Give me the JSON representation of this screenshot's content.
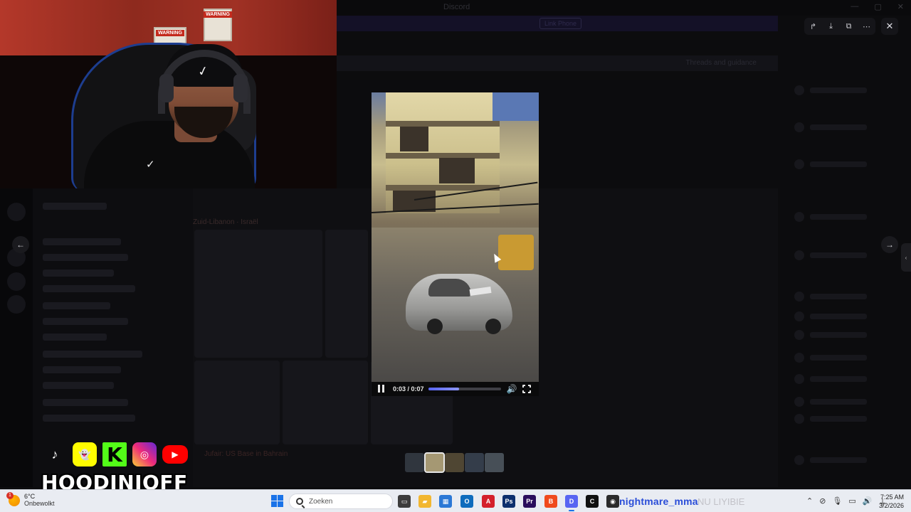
{
  "background": {
    "app_title": "Discord",
    "banner_button": "Link Phone",
    "channel_button": "Threads and guidance",
    "post_title_a": "Zuid-Libanon",
    "post_title_b": "Israël",
    "bottom_link": "Jufair: US Base in Bahrain"
  },
  "lightbox": {
    "actions": [
      {
        "name": "forward-icon",
        "glyph": "↱"
      },
      {
        "name": "download-icon",
        "glyph": "⤓"
      },
      {
        "name": "open-external-icon",
        "glyph": "⧉"
      },
      {
        "name": "more-icon",
        "glyph": "⋯"
      }
    ],
    "close_glyph": "✕",
    "prev_glyph": "←",
    "next_glyph": "→",
    "side_tab_glyph": "‹"
  },
  "video": {
    "time_text": "0:03 / 0:07",
    "progress_fraction": 0.43,
    "volume_glyph": "🔊"
  },
  "thumbnails": [
    {
      "color": "#46505c",
      "active": false
    },
    {
      "color": "#a59873",
      "active": true
    },
    {
      "color": "#7a6a4a",
      "active": false
    },
    {
      "color": "#4c5b70",
      "active": false
    },
    {
      "color": "#6d7a86",
      "active": false
    }
  ],
  "overlay": {
    "social": [
      {
        "name": "tiktok-icon",
        "glyph": "♪"
      },
      {
        "name": "snapchat-icon",
        "glyph": "👻"
      },
      {
        "name": "kick-icon",
        "glyph": "K"
      },
      {
        "name": "instagram-icon",
        "glyph": "◎"
      },
      {
        "name": "youtube-icon",
        "glyph": "▶"
      }
    ],
    "brand": "HOODINIOFF"
  },
  "webcam": {
    "sign_text": "WARNING"
  },
  "taskbar": {
    "weather_temp": "6°C",
    "weather_desc": "Onbewolkt",
    "weather_badge": "1",
    "search_placeholder": "Zoeken",
    "apps": [
      {
        "name": "task-view-icon",
        "label": "▭",
        "color": "#3c3c3c"
      },
      {
        "name": "file-explorer-icon",
        "label": "▰",
        "color": "#f2b731"
      },
      {
        "name": "store-icon",
        "label": "▦",
        "color": "#2b78d6"
      },
      {
        "name": "outlook-icon",
        "label": "O",
        "color": "#0f6cbd"
      },
      {
        "name": "acrobat-icon",
        "label": "A",
        "color": "#d4202c"
      },
      {
        "name": "photoshop-icon",
        "label": "Ps",
        "color": "#0d2f6e"
      },
      {
        "name": "premiere-icon",
        "label": "Pr",
        "color": "#2a0d5c"
      },
      {
        "name": "brave-icon",
        "label": "B",
        "color": "#f04a1d"
      },
      {
        "name": "discord-icon",
        "label": "D",
        "color": "#5865f2"
      },
      {
        "name": "capcut-icon",
        "label": "C",
        "color": "#111111"
      },
      {
        "name": "obs-icon",
        "label": "◉",
        "color": "#2b2b2b"
      }
    ],
    "stream_label": "nightmare_mma",
    "stream_label2": "NU LIYIBIE",
    "tray": [
      "⌃",
      "⊘",
      "🎙",
      "▭",
      "🔊",
      "⏚"
    ],
    "time": "7:25 AM",
    "date": "3/2/2026"
  }
}
